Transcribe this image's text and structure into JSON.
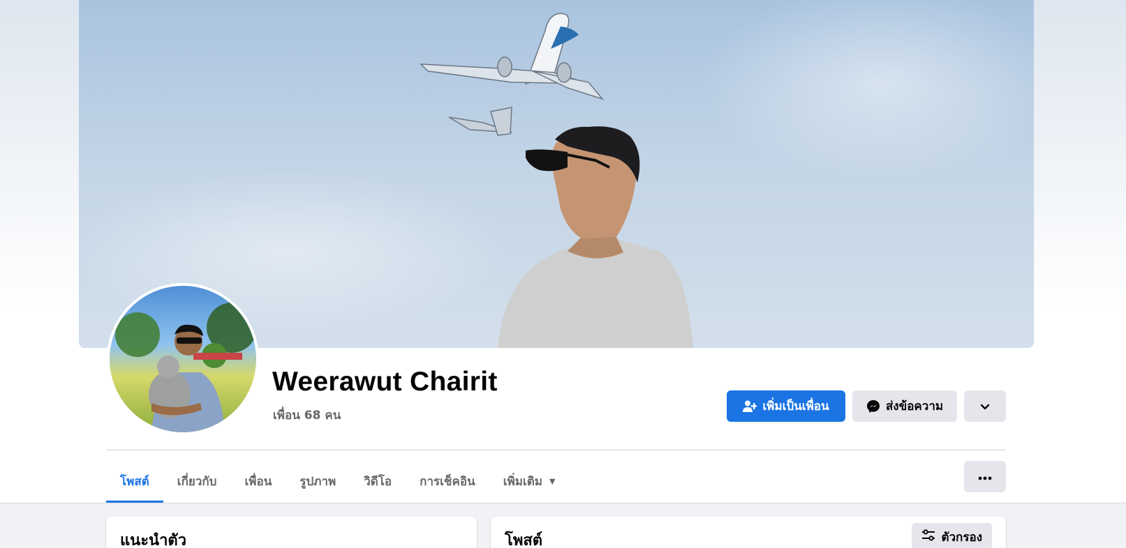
{
  "profile": {
    "name": "Weerawut Chairit",
    "friend_count": "เพื่อน 68 คน"
  },
  "actions": {
    "add_friend_label": "เพิ่มเป็นเพื่อน",
    "message_label": "ส่งข้อความ"
  },
  "tabs": [
    {
      "label": "โพสต์",
      "active": true
    },
    {
      "label": "เกี่ยวกับ",
      "active": false
    },
    {
      "label": "เพื่อน",
      "active": false
    },
    {
      "label": "รูปภาพ",
      "active": false
    },
    {
      "label": "วิดีโอ",
      "active": false
    },
    {
      "label": "การเช็คอิน",
      "active": false
    },
    {
      "label": "เพิ่มเติม",
      "active": false
    }
  ],
  "intro_card": {
    "title": "แนะนำตัว"
  },
  "posts_card": {
    "title": "โพสต์",
    "filter_label": "ตัวกรอง"
  },
  "colors": {
    "accent": "#1b74e4",
    "secondary_button": "#e4e6eb",
    "muted_text": "#65676b"
  },
  "icons": {
    "add_friend": "person-add-icon",
    "message": "messenger-icon",
    "dropdown": "chevron-down-icon",
    "more": "ellipsis-icon",
    "filter": "sliders-icon",
    "tab_more_caret": "caret-down-icon"
  }
}
